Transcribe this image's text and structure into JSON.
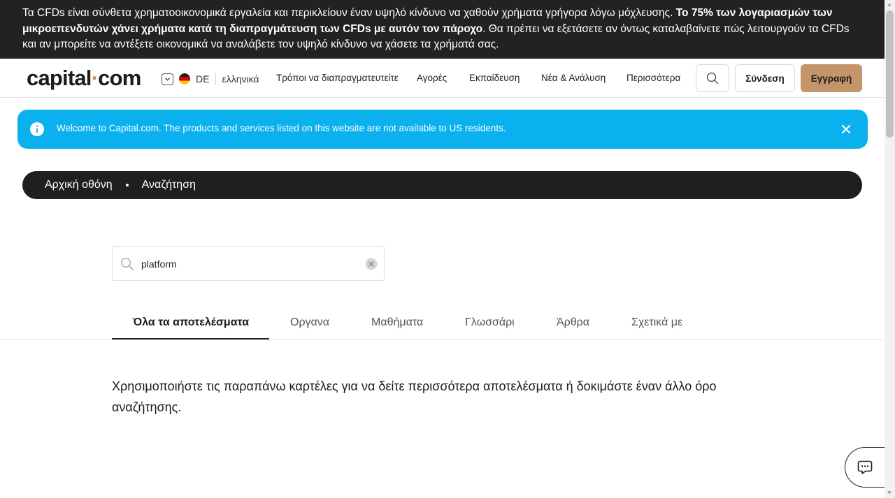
{
  "risk_banner": {
    "text_1": "Τα CFDs είναι σύνθετα χρηματοοικονομικά εργαλεία και περικλείουν έναν υψηλό κίνδυνο να χαθούν χρήματα γρήγορα λόγω μόχλευσης. ",
    "bold": "Το 75% των λογαριασμών των μικροεπενδυτών χάνει χρήματα κατά τη διαπραγμάτευση των CFDs με αυτόν τον πάροχο",
    "text_2": ". Θα πρέπει να εξετάσετε αν όντως καταλαβαίνετε πώς λειτουργούν τα CFDs και αν μπορείτε να αντέξετε οικονομικά να αναλάβετε τον υψηλό κίνδυνο να χάσετε τα χρήματά σας."
  },
  "header": {
    "logo_left": "capital",
    "logo_dot": "·",
    "logo_right": "com",
    "country_code": "DE",
    "language": "ελληνικά",
    "nav": [
      "Τρόποι να διαπραγματευτείτε",
      "Αγορές",
      "Εκπαίδευση",
      "Νέα & Ανάλυση",
      "Περισσότερα"
    ],
    "login_label": "Σύνδεση",
    "signup_label": "Εγγραφή"
  },
  "info_banner": {
    "message": "Welcome to Capital.com. The products and services listed on this website are not available to US residents."
  },
  "breadcrumb": {
    "home": "Αρχική οθόνη",
    "current": "Αναζήτηση"
  },
  "search": {
    "value": "platform"
  },
  "tabs": [
    "Όλα τα αποτελέσματα",
    "Οργανα",
    "Μαθήματα",
    "Γλωσσάρι",
    "Άρθρα",
    "Σχετικά με"
  ],
  "results": {
    "hint": "Χρησιμοποιήστε τις παραπάνω καρτέλες για να δείτε περισσότερα αποτελέσματα ή δοκιμάστε έναν άλλο όρο αναζήτησης."
  },
  "colors": {
    "risk_banner_bg": "#222222",
    "info_banner_bg": "#0bb1ef",
    "signup_bg": "#c4946a",
    "breadcrumb_bg": "#1f1f1f"
  },
  "icons": [
    "chevron-down-icon",
    "germany-flag-icon",
    "search-icon",
    "info-icon",
    "close-icon",
    "clear-icon",
    "chat-icon"
  ]
}
